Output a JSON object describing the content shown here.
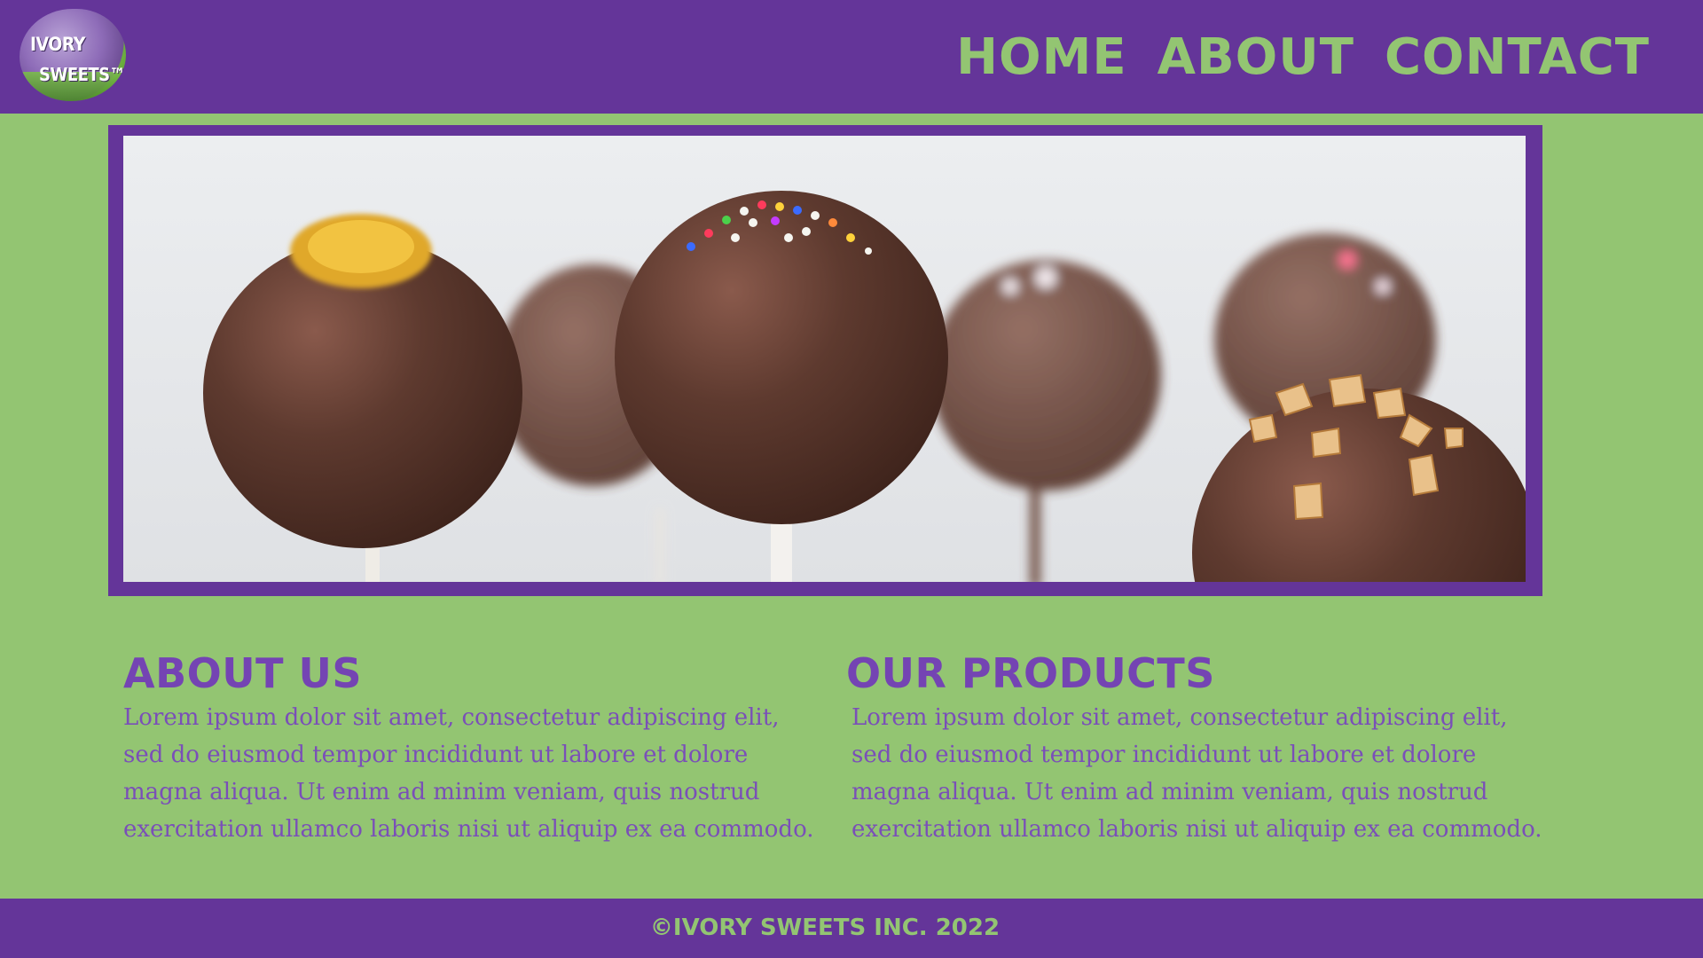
{
  "brand": {
    "logo_line1": "IVORY",
    "logo_line2": "SWEETS™"
  },
  "nav": {
    "items": [
      {
        "label": "HOME"
      },
      {
        "label": "ABOUT"
      },
      {
        "label": "CONTACT"
      }
    ]
  },
  "hero": {
    "image_subject": "chocolate-cake-pops-photo"
  },
  "about": {
    "heading": "ABOUT US",
    "body": "Lorem ipsum dolor sit amet, consectetur adipiscing elit, sed do eiusmod tempor incididunt ut labore et dolore magna aliqua. Ut enim ad minim veniam, quis nostrud exercitation ullamco laboris nisi ut aliquip ex ea commodo."
  },
  "products": {
    "heading": "OUR PRODUCTS",
    "body": "Lorem ipsum dolor sit amet, consectetur adipiscing elit, sed do eiusmod tempor incididunt ut labore et dolore magna aliqua. Ut enim ad minim veniam, quis nostrud exercitation ullamco laboris nisi ut aliquip ex ea commodo."
  },
  "footer": {
    "copyright": "©IVORY SWEETS INC. 2022"
  },
  "colors": {
    "header_purple": "#643599",
    "page_green": "#93c572",
    "heading_purple": "#7444b3",
    "chocolate": "#5a3328"
  }
}
